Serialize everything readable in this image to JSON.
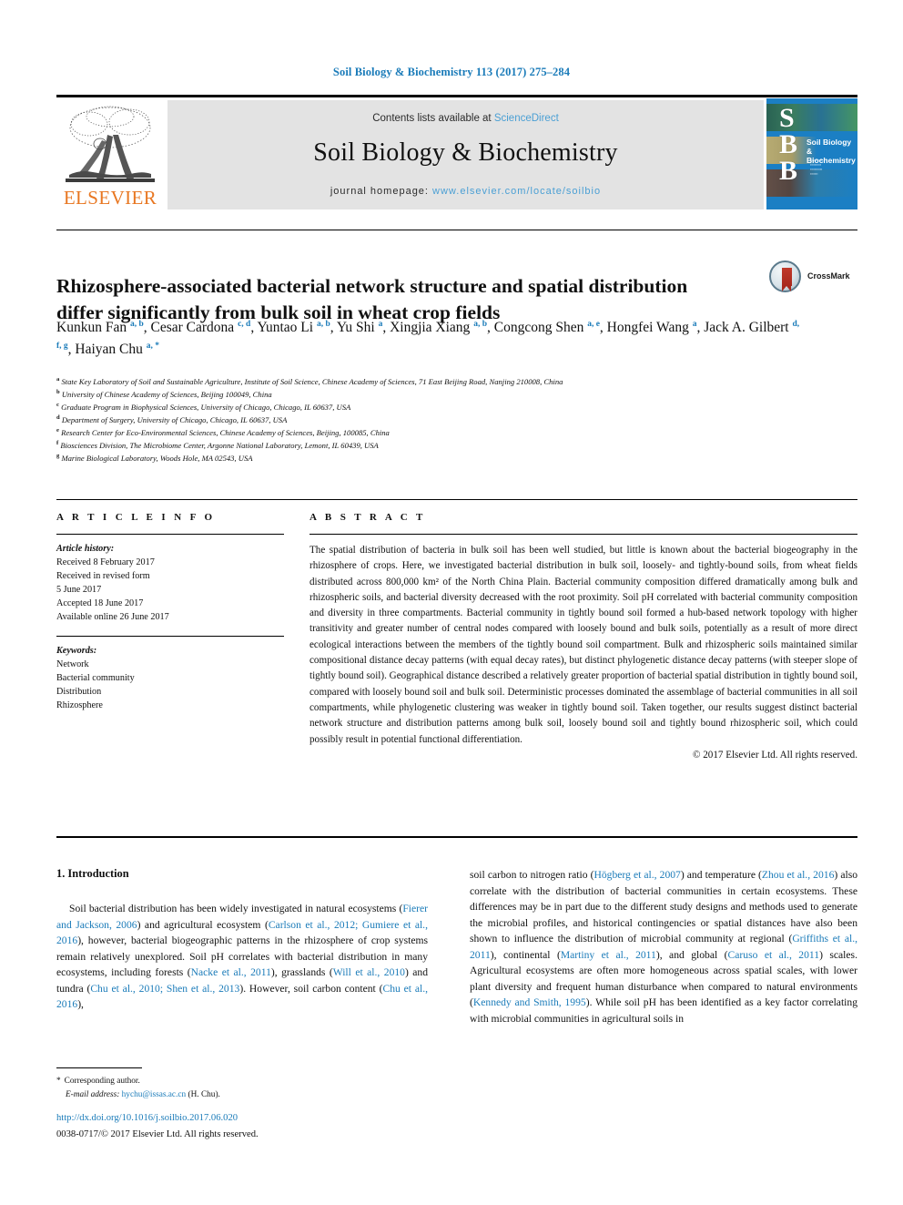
{
  "running_head": "Soil Biology & Biochemistry 113 (2017) 275–284",
  "masthead": {
    "contents_prefix": "Contents lists available at ",
    "sciencedirect": "ScienceDirect",
    "journal_title": "Soil Biology & Biochemistry",
    "homepage_prefix": "journal homepage: ",
    "homepage_url": "www.elsevier.com/locate/soilbio",
    "publisher": "ELSEVIER",
    "cover": {
      "letters": "S\nB\nB",
      "title_line1": "Soil Biology &",
      "title_line2": "Biochemistry"
    },
    "colors": {
      "panel_bg": "#e3e3e3",
      "link": "#4a9fd4",
      "elsevier_orange": "#e87722",
      "cover_blue": "#1b7fc4"
    }
  },
  "article": {
    "title": "Rhizosphere-associated bacterial network structure and spatial distribution differ significantly from bulk soil in wheat crop fields",
    "crossmark_label": "CrossMark",
    "authors_html": "Kunkun Fan <sup>a, b</sup>, Cesar Cardona <sup>c, d</sup>, Yuntao Li <sup>a, b</sup>, Yu Shi <sup>a</sup>, Xingjia Xiang <sup>a, b</sup>, Congcong Shen <sup>a, e</sup>, Hongfei Wang <sup>a</sup>, Jack A. Gilbert <sup>d, f, g</sup>, Haiyan Chu <sup>a, *</sup>",
    "affiliations": [
      {
        "mark": "a",
        "text": "State Key Laboratory of Soil and Sustainable Agriculture, Institute of Soil Science, Chinese Academy of Sciences, 71 East Beijing Road, Nanjing 210008, China"
      },
      {
        "mark": "b",
        "text": "University of Chinese Academy of Sciences, Beijing 100049, China"
      },
      {
        "mark": "c",
        "text": "Graduate Program in Biophysical Sciences, University of Chicago, Chicago, IL 60637, USA"
      },
      {
        "mark": "d",
        "text": "Department of Surgery, University of Chicago, Chicago, IL 60637, USA"
      },
      {
        "mark": "e",
        "text": "Research Center for Eco-Environmental Sciences, Chinese Academy of Sciences, Beijing, 100085, China"
      },
      {
        "mark": "f",
        "text": "Biosciences Division, The Microbiome Center, Argonne National Laboratory, Lemont, IL 60439, USA"
      },
      {
        "mark": "g",
        "text": "Marine Biological Laboratory, Woods Hole, MA 02543, USA"
      }
    ]
  },
  "article_info": {
    "heading": "A R T I C L E  I N F O",
    "history_label": "Article history:",
    "history_lines": [
      "Received 8 February 2017",
      "Received in revised form",
      "5 June 2017",
      "Accepted 18 June 2017",
      "Available online 26 June 2017"
    ],
    "keywords_label": "Keywords:",
    "keywords": [
      "Network",
      "Bacterial community",
      "Distribution",
      "Rhizosphere"
    ]
  },
  "abstract": {
    "heading": "A B S T R A C T",
    "text": "The spatial distribution of bacteria in bulk soil has been well studied, but little is known about the bacterial biogeography in the rhizosphere of crops. Here, we investigated bacterial distribution in bulk soil, loosely- and tightly-bound soils, from wheat fields distributed across 800,000 km² of the North China Plain. Bacterial community composition differed dramatically among bulk and rhizospheric soils, and bacterial diversity decreased with the root proximity. Soil pH correlated with bacterial community composition and diversity in three compartments. Bacterial community in tightly bound soil formed a hub-based network topology with higher transitivity and greater number of central nodes compared with loosely bound and bulk soils, potentially as a result of more direct ecological interactions between the members of the tightly bound soil compartment. Bulk and rhizospheric soils maintained similar compositional distance decay patterns (with equal decay rates), but distinct phylogenetic distance decay patterns (with steeper slope of tightly bound soil). Geographical distance described a relatively greater proportion of bacterial spatial distribution in tightly bound soil, compared with loosely bound soil and bulk soil. Deterministic processes dominated the assemblage of bacterial communities in all soil compartments, while phylogenetic clustering was weaker in tightly bound soil. Taken together, our results suggest distinct bacterial network structure and distribution patterns among bulk soil, loosely bound soil and tightly bound rhizospheric soil, which could possibly result in potential functional differentiation.",
    "copyright": "© 2017 Elsevier Ltd. All rights reserved."
  },
  "introduction": {
    "section_number_title": "1. Introduction",
    "left_paragraph_html": "Soil bacterial distribution has been widely investigated in natural ecosystems (<span class=\"ref\">Fierer and Jackson, 2006</span>) and agricultural ecosystem (<span class=\"ref\">Carlson et al., 2012; Gumiere et al., 2016</span>), however, bacterial biogeographic patterns in the rhizosphere of crop systems remain relatively unexplored. Soil pH correlates with bacterial distribution in many ecosystems, including forests (<span class=\"ref\">Nacke et al., 2011</span>), grasslands (<span class=\"ref\">Will et al., 2010</span>) and tundra (<span class=\"ref\">Chu et al., 2010; Shen et al., 2013</span>). However, soil carbon content (<span class=\"ref\">Chu et al., 2016</span>),",
    "right_paragraph_html": "soil carbon to nitrogen ratio (<span class=\"ref\">Högberg et al., 2007</span>) and temperature (<span class=\"ref\">Zhou et al., 2016</span>) also correlate with the distribution of bacterial communities in certain ecosystems. These differences may be in part due to the different study designs and methods used to generate the microbial profiles, and historical contingencies or spatial distances have also been shown to influence the distribution of microbial community at regional (<span class=\"ref\">Griffiths et al., 2011</span>), continental (<span class=\"ref\">Martiny et al., 2011</span>), and global (<span class=\"ref\">Caruso et al., 2011</span>) scales. Agricultural ecosystems are often more homogeneous across spatial scales, with lower plant diversity and frequent human disturbance when compared to natural environments (<span class=\"ref\">Kennedy and Smith, 1995</span>). While soil pH has been identified as a key factor correlating with microbial communities in agricultural soils in"
  },
  "footnote": {
    "corresponding_author": "Corresponding author.",
    "email_label": "E-mail address:",
    "email": "hychu@issas.ac.cn",
    "email_suffix": "(H. Chu)."
  },
  "footer": {
    "doi": "http://dx.doi.org/10.1016/j.soilbio.2017.06.020",
    "issn_copyright": "0038-0717/© 2017 Elsevier Ltd. All rights reserved."
  }
}
